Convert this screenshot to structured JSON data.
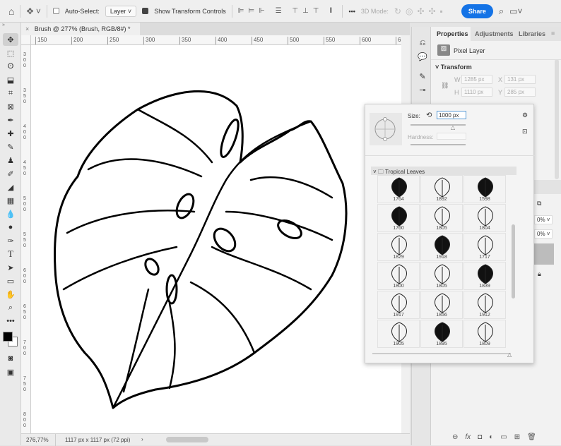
{
  "options_bar": {
    "auto_select_label": "Auto-Select:",
    "auto_select_value": "Layer",
    "show_transform_label": "Show Transform Controls",
    "mode_3d_label": "3D Mode:",
    "share_label": "Share",
    "more": "•••"
  },
  "document": {
    "tab_title": "Brush @ 277% (Brush, RGB/8#) *",
    "close": "×"
  },
  "rulers": {
    "horizontal": [
      "150",
      "200",
      "250",
      "300",
      "350",
      "400",
      "450",
      "500",
      "550",
      "600",
      "6"
    ],
    "vertical": [
      "300",
      "350",
      "400",
      "450",
      "500",
      "550",
      "600",
      "650",
      "700",
      "750",
      "800"
    ]
  },
  "status": {
    "zoom": "276,77%",
    "doc_info": "1117 px x 1117 px (72 ppi)",
    "arrow": "›"
  },
  "properties_panel": {
    "tabs": [
      "Properties",
      "Adjustments",
      "Libraries"
    ],
    "layer_type": "Pixel Layer",
    "section": "Transform",
    "w_label": "W",
    "w_value": "1285 px",
    "x_label": "X",
    "x_value": "131 px",
    "h_label": "H",
    "h_value": "1110 px",
    "y_label": "Y",
    "y_value": "285 px"
  },
  "brush_popup": {
    "size_label": "Size:",
    "size_value": "1000 px",
    "hardness_label": "Hardness:",
    "size_fraction": 0.78,
    "folder": "Tropical Leaves",
    "brushes": [
      {
        "n": "1764",
        "fill": true
      },
      {
        "n": "1892",
        "fill": false
      },
      {
        "n": "1598",
        "fill": true
      },
      {
        "n": "1760",
        "fill": true
      },
      {
        "n": "1805",
        "fill": false
      },
      {
        "n": "1804",
        "fill": false
      },
      {
        "n": "1829",
        "fill": false
      },
      {
        "n": "1918",
        "fill": true
      },
      {
        "n": "1717",
        "fill": false
      },
      {
        "n": "1800",
        "fill": false
      },
      {
        "n": "1805",
        "fill": false
      },
      {
        "n": "1839",
        "fill": true
      },
      {
        "n": "1917",
        "fill": false
      },
      {
        "n": "1856",
        "fill": false
      },
      {
        "n": "1912",
        "fill": false
      },
      {
        "n": "1905",
        "fill": false
      },
      {
        "n": "1895",
        "fill": true
      },
      {
        "n": "1809",
        "fill": false
      }
    ]
  },
  "layers_panel": {
    "opacity_value": "0%",
    "fill_value": "0%"
  },
  "colors": {
    "accent": "#1473e6",
    "foreground": "#000000",
    "background": "#ffffff"
  }
}
